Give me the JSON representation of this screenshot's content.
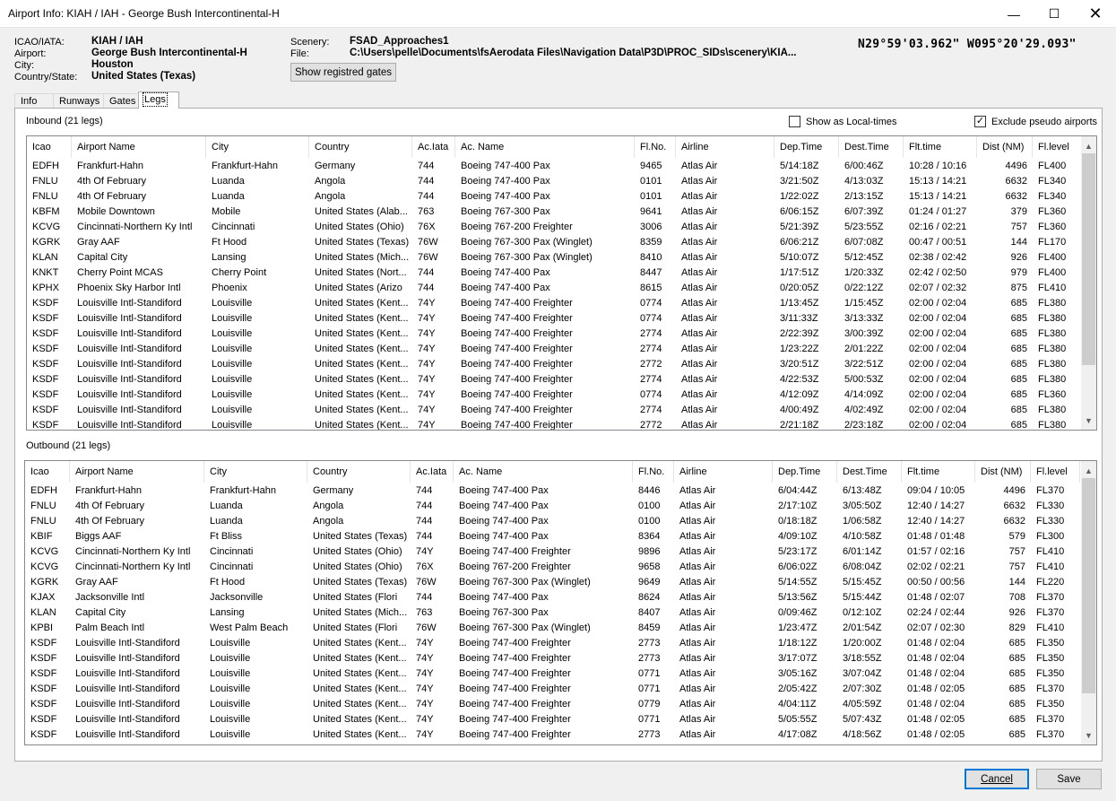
{
  "window": {
    "title": "Airport Info: KIAH / IAH - George Bush Intercontinental-H",
    "minimize_glyph": "—",
    "maximize_glyph": "☐",
    "close_glyph": "✕"
  },
  "airport": {
    "icao_label": "ICAO/IATA:",
    "icao_value": "KIAH / IAH",
    "airport_label": "Airport:",
    "airport_value": "George Bush Intercontinental-H",
    "city_label": "City:",
    "city_value": "Houston",
    "country_label": "Country/State:",
    "country_value": "United States (Texas)",
    "scenery_label": "Scenery:",
    "scenery_value": "FSAD_Approaches1",
    "file_label": "File:",
    "file_value": "C:\\Users\\pelle\\Documents\\fsAerodata Files\\Navigation Data\\P3D\\PROC_SIDs\\scenery\\KIA...",
    "coordinates": "N29°59'03.962\" W095°20'29.093\"",
    "gates_button": "Show registred gates"
  },
  "tabs": [
    "Info",
    "Runways",
    "Gates",
    "Legs"
  ],
  "active_tab": "Legs",
  "options": {
    "local_times_label": "Show as Local-times",
    "local_times_checked": false,
    "exclude_pseudo_label": "Exclude pseudo airports",
    "exclude_pseudo_checked": true
  },
  "columns": [
    "Icao",
    "Airport Name",
    "City",
    "Country",
    "Ac.Iata",
    "Ac. Name",
    "Fl.No.",
    "Airline",
    "Dep.Time",
    "Dest.Time",
    "Flt.time",
    "Dist (NM)",
    "Fl.level"
  ],
  "scroll_arrows": {
    "up": "▲",
    "down": "▼"
  },
  "inbound": {
    "title": "Inbound (21 legs)",
    "rows": [
      [
        "EDFH",
        "Frankfurt-Hahn",
        "Frankfurt-Hahn",
        "Germany",
        "744",
        "Boeing 747-400 Pax",
        "9465",
        "Atlas Air",
        "5/14:18Z",
        "6/00:46Z",
        "10:28 / 10:16",
        "4496",
        "FL400"
      ],
      [
        "FNLU",
        "4th Of February",
        "Luanda",
        "Angola",
        "744",
        "Boeing 747-400 Pax",
        "0101",
        "Atlas Air",
        "3/21:50Z",
        "4/13:03Z",
        "15:13 / 14:21",
        "6632",
        "FL340"
      ],
      [
        "FNLU",
        "4th Of February",
        "Luanda",
        "Angola",
        "744",
        "Boeing 747-400 Pax",
        "0101",
        "Atlas Air",
        "1/22:02Z",
        "2/13:15Z",
        "15:13 / 14:21",
        "6632",
        "FL340"
      ],
      [
        "KBFM",
        "Mobile Downtown",
        "Mobile",
        "United States (Alab...",
        "763",
        "Boeing 767-300 Pax",
        "9641",
        "Atlas Air",
        "6/06:15Z",
        "6/07:39Z",
        "01:24 / 01:27",
        "379",
        "FL360"
      ],
      [
        "KCVG",
        "Cincinnati-Northern Ky Intl",
        "Cincinnati",
        "United States (Ohio)",
        "76X",
        "Boeing 767-200 Freighter",
        "3006",
        "Atlas Air",
        "5/21:39Z",
        "5/23:55Z",
        "02:16 / 02:21",
        "757",
        "FL360"
      ],
      [
        "KGRK",
        "Gray AAF",
        "Ft Hood",
        "United States (Texas)",
        "76W",
        "Boeing 767-300 Pax (Winglet)",
        "8359",
        "Atlas Air",
        "6/06:21Z",
        "6/07:08Z",
        "00:47 / 00:51",
        "144",
        "FL170"
      ],
      [
        "KLAN",
        "Capital City",
        "Lansing",
        "United States (Mich...",
        "76W",
        "Boeing 767-300 Pax (Winglet)",
        "8410",
        "Atlas Air",
        "5/10:07Z",
        "5/12:45Z",
        "02:38 / 02:42",
        "926",
        "FL400"
      ],
      [
        "KNKT",
        "Cherry Point MCAS",
        "Cherry Point",
        "United States (Nort...",
        "744",
        "Boeing 747-400 Pax",
        "8447",
        "Atlas Air",
        "1/17:51Z",
        "1/20:33Z",
        "02:42 / 02:50",
        "979",
        "FL400"
      ],
      [
        "KPHX",
        "Phoenix Sky Harbor Intl",
        "Phoenix",
        "United States (Arizo",
        "744",
        "Boeing 747-400 Pax",
        "8615",
        "Atlas Air",
        "0/20:05Z",
        "0/22:12Z",
        "02:07 / 02:32",
        "875",
        "FL410"
      ],
      [
        "KSDF",
        "Louisville Intl-Standiford",
        "Louisville",
        "United States (Kent...",
        "74Y",
        "Boeing 747-400 Freighter",
        "0774",
        "Atlas Air",
        "1/13:45Z",
        "1/15:45Z",
        "02:00 / 02:04",
        "685",
        "FL380"
      ],
      [
        "KSDF",
        "Louisville Intl-Standiford",
        "Louisville",
        "United States (Kent...",
        "74Y",
        "Boeing 747-400 Freighter",
        "0774",
        "Atlas Air",
        "3/11:33Z",
        "3/13:33Z",
        "02:00 / 02:04",
        "685",
        "FL380"
      ],
      [
        "KSDF",
        "Louisville Intl-Standiford",
        "Louisville",
        "United States (Kent...",
        "74Y",
        "Boeing 747-400 Freighter",
        "2774",
        "Atlas Air",
        "2/22:39Z",
        "3/00:39Z",
        "02:00 / 02:04",
        "685",
        "FL380"
      ],
      [
        "KSDF",
        "Louisville Intl-Standiford",
        "Louisville",
        "United States (Kent...",
        "74Y",
        "Boeing 747-400 Freighter",
        "2774",
        "Atlas Air",
        "1/23:22Z",
        "2/01:22Z",
        "02:00 / 02:04",
        "685",
        "FL380"
      ],
      [
        "KSDF",
        "Louisville Intl-Standiford",
        "Louisville",
        "United States (Kent...",
        "74Y",
        "Boeing 747-400 Freighter",
        "2772",
        "Atlas Air",
        "3/20:51Z",
        "3/22:51Z",
        "02:00 / 02:04",
        "685",
        "FL380"
      ],
      [
        "KSDF",
        "Louisville Intl-Standiford",
        "Louisville",
        "United States (Kent...",
        "74Y",
        "Boeing 747-400 Freighter",
        "2774",
        "Atlas Air",
        "4/22:53Z",
        "5/00:53Z",
        "02:00 / 02:04",
        "685",
        "FL380"
      ],
      [
        "KSDF",
        "Louisville Intl-Standiford",
        "Louisville",
        "United States (Kent...",
        "74Y",
        "Boeing 747-400 Freighter",
        "0774",
        "Atlas Air",
        "4/12:09Z",
        "4/14:09Z",
        "02:00 / 02:04",
        "685",
        "FL360"
      ],
      [
        "KSDF",
        "Louisville Intl-Standiford",
        "Louisville",
        "United States (Kent...",
        "74Y",
        "Boeing 747-400 Freighter",
        "2774",
        "Atlas Air",
        "4/00:49Z",
        "4/02:49Z",
        "02:00 / 02:04",
        "685",
        "FL380"
      ],
      [
        "KSDF",
        "Louisville Intl-Standiford",
        "Louisville",
        "United States (Kent...",
        "74Y",
        "Boeing 747-400 Freighter",
        "2772",
        "Atlas Air",
        "2/21:18Z",
        "2/23:18Z",
        "02:00 / 02:04",
        "685",
        "FL380"
      ]
    ]
  },
  "outbound": {
    "title": "Outbound (21 legs)",
    "rows": [
      [
        "EDFH",
        "Frankfurt-Hahn",
        "Frankfurt-Hahn",
        "Germany",
        "744",
        "Boeing 747-400 Pax",
        "8446",
        "Atlas Air",
        "6/04:44Z",
        "6/13:48Z",
        "09:04 / 10:05",
        "4496",
        "FL370"
      ],
      [
        "FNLU",
        "4th Of February",
        "Luanda",
        "Angola",
        "744",
        "Boeing 747-400 Pax",
        "0100",
        "Atlas Air",
        "2/17:10Z",
        "3/05:50Z",
        "12:40 / 14:27",
        "6632",
        "FL330"
      ],
      [
        "FNLU",
        "4th Of February",
        "Luanda",
        "Angola",
        "744",
        "Boeing 747-400 Pax",
        "0100",
        "Atlas Air",
        "0/18:18Z",
        "1/06:58Z",
        "12:40 / 14:27",
        "6632",
        "FL330"
      ],
      [
        "KBIF",
        "Biggs AAF",
        "Ft Bliss",
        "United States (Texas)",
        "744",
        "Boeing 747-400 Pax",
        "8364",
        "Atlas Air",
        "4/09:10Z",
        "4/10:58Z",
        "01:48 / 01:48",
        "579",
        "FL300"
      ],
      [
        "KCVG",
        "Cincinnati-Northern Ky Intl",
        "Cincinnati",
        "United States (Ohio)",
        "74Y",
        "Boeing 747-400 Freighter",
        "9896",
        "Atlas Air",
        "5/23:17Z",
        "6/01:14Z",
        "01:57 / 02:16",
        "757",
        "FL410"
      ],
      [
        "KCVG",
        "Cincinnati-Northern Ky Intl",
        "Cincinnati",
        "United States (Ohio)",
        "76X",
        "Boeing 767-200 Freighter",
        "9658",
        "Atlas Air",
        "6/06:02Z",
        "6/08:04Z",
        "02:02 / 02:21",
        "757",
        "FL410"
      ],
      [
        "KGRK",
        "Gray AAF",
        "Ft Hood",
        "United States (Texas)",
        "76W",
        "Boeing 767-300 Pax (Winglet)",
        "9649",
        "Atlas Air",
        "5/14:55Z",
        "5/15:45Z",
        "00:50 / 00:56",
        "144",
        "FL220"
      ],
      [
        "KJAX",
        "Jacksonville Intl",
        "Jacksonville",
        "United States (Flori",
        "744",
        "Boeing 747-400 Pax",
        "8624",
        "Atlas Air",
        "5/13:56Z",
        "5/15:44Z",
        "01:48 / 02:07",
        "708",
        "FL370"
      ],
      [
        "KLAN",
        "Capital City",
        "Lansing",
        "United States (Mich...",
        "763",
        "Boeing 767-300 Pax",
        "8407",
        "Atlas Air",
        "0/09:46Z",
        "0/12:10Z",
        "02:24 / 02:44",
        "926",
        "FL370"
      ],
      [
        "KPBI",
        "Palm Beach Intl",
        "West Palm Beach",
        "United States (Flori",
        "76W",
        "Boeing 767-300 Pax (Winglet)",
        "8459",
        "Atlas Air",
        "1/23:47Z",
        "2/01:54Z",
        "02:07 / 02:30",
        "829",
        "FL410"
      ],
      [
        "KSDF",
        "Louisville Intl-Standiford",
        "Louisville",
        "United States (Kent...",
        "74Y",
        "Boeing 747-400 Freighter",
        "2773",
        "Atlas Air",
        "1/18:12Z",
        "1/20:00Z",
        "01:48 / 02:04",
        "685",
        "FL350"
      ],
      [
        "KSDF",
        "Louisville Intl-Standiford",
        "Louisville",
        "United States (Kent...",
        "74Y",
        "Boeing 747-400 Freighter",
        "2773",
        "Atlas Air",
        "3/17:07Z",
        "3/18:55Z",
        "01:48 / 02:04",
        "685",
        "FL350"
      ],
      [
        "KSDF",
        "Louisville Intl-Standiford",
        "Louisville",
        "United States (Kent...",
        "74Y",
        "Boeing 747-400 Freighter",
        "0771",
        "Atlas Air",
        "3/05:16Z",
        "3/07:04Z",
        "01:48 / 02:04",
        "685",
        "FL350"
      ],
      [
        "KSDF",
        "Louisville Intl-Standiford",
        "Louisville",
        "United States (Kent...",
        "74Y",
        "Boeing 747-400 Freighter",
        "0771",
        "Atlas Air",
        "2/05:42Z",
        "2/07:30Z",
        "01:48 / 02:05",
        "685",
        "FL370"
      ],
      [
        "KSDF",
        "Louisville Intl-Standiford",
        "Louisville",
        "United States (Kent...",
        "74Y",
        "Boeing 747-400 Freighter",
        "0779",
        "Atlas Air",
        "4/04:11Z",
        "4/05:59Z",
        "01:48 / 02:04",
        "685",
        "FL350"
      ],
      [
        "KSDF",
        "Louisville Intl-Standiford",
        "Louisville",
        "United States (Kent...",
        "74Y",
        "Boeing 747-400 Freighter",
        "0771",
        "Atlas Air",
        "5/05:55Z",
        "5/07:43Z",
        "01:48 / 02:05",
        "685",
        "FL370"
      ],
      [
        "KSDF",
        "Louisville Intl-Standiford",
        "Louisville",
        "United States (Kent...",
        "74Y",
        "Boeing 747-400 Freighter",
        "2773",
        "Atlas Air",
        "4/17:08Z",
        "4/18:56Z",
        "01:48 / 02:05",
        "685",
        "FL370"
      ]
    ]
  },
  "footer": {
    "cancel_label": "Cancel",
    "save_label": "Save"
  }
}
